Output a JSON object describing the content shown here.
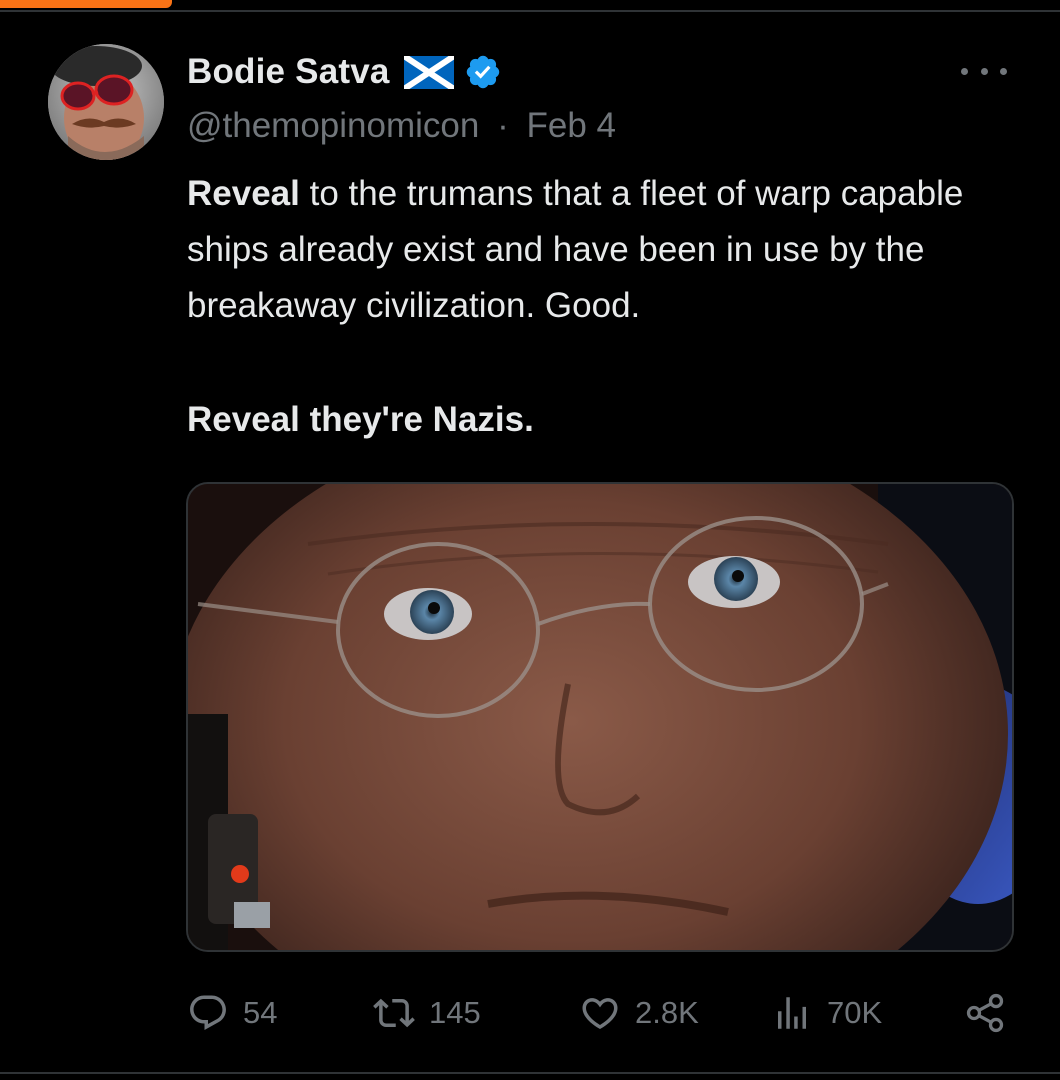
{
  "tweet": {
    "author": {
      "display_name": "Bodie Satva",
      "handle": "@themopinomicon",
      "flag": "scotland-flag-icon",
      "verified": true
    },
    "separator": "·",
    "date": "Feb 4",
    "body": {
      "line1_bold": "Reveal",
      "line1_rest": " to the trumans that a fleet of warp capable ships already exist and have been in use by the breakaway civilization. Good.",
      "line2": "Reveal they're Nazis."
    },
    "media": {
      "kind": "photo"
    },
    "actions": {
      "replies": "54",
      "reposts": "145",
      "likes": "2.8K",
      "views": "70K"
    }
  },
  "colors": {
    "background": "#000000",
    "text": "#e7e9ea",
    "muted": "#71767b",
    "verified": "#1d9bf0",
    "divider": "#2f3336",
    "accent": "#f97316",
    "flag_blue": "#0065bd"
  }
}
